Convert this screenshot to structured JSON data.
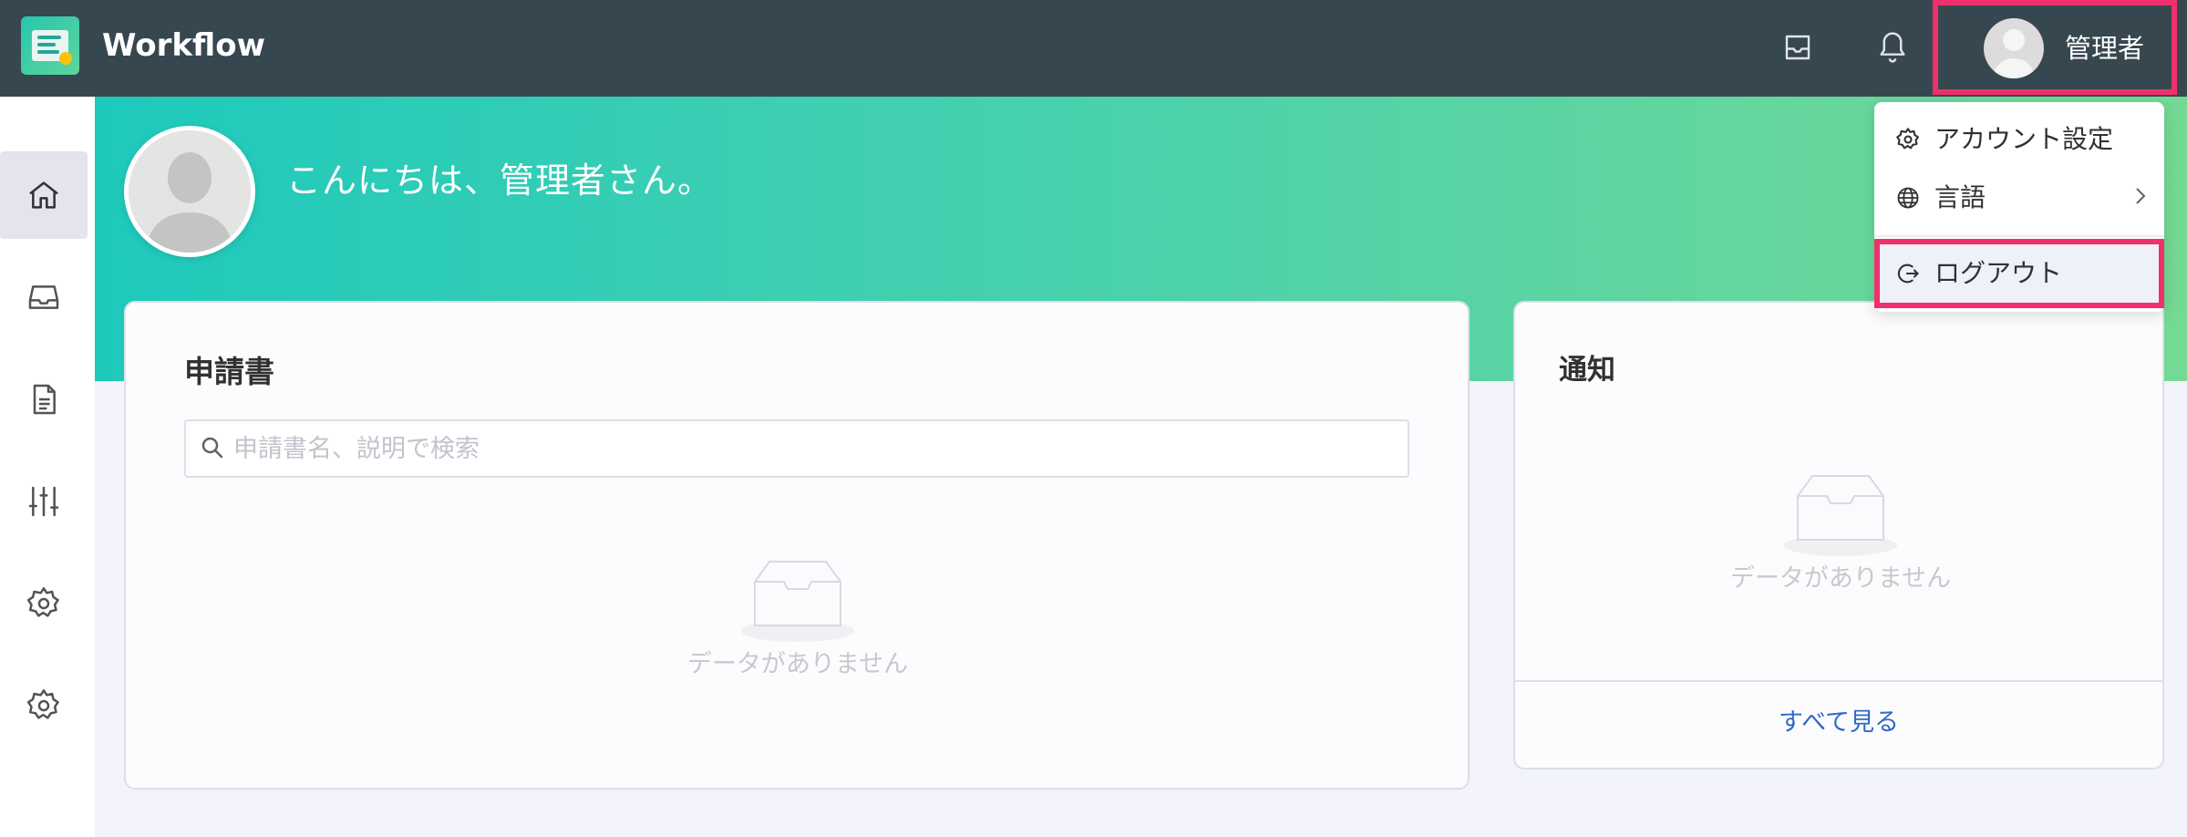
{
  "header": {
    "app_title": "Workflow",
    "user_name": "管理者",
    "icons": [
      "inbox-icon",
      "bell-icon"
    ]
  },
  "banner": {
    "greeting": "こんにちは、管理者さん。"
  },
  "sidebar": {
    "items": [
      {
        "icon": "home-icon",
        "active": true
      },
      {
        "icon": "inbox-icon",
        "active": false
      },
      {
        "icon": "document-icon",
        "active": false
      },
      {
        "icon": "sliders-icon",
        "active": false
      },
      {
        "icon": "gear-icon",
        "active": false
      },
      {
        "icon": "gear-icon",
        "active": false
      }
    ]
  },
  "applications_card": {
    "title": "申請書",
    "search_placeholder": "申請書名、説明で検索",
    "empty_text": "データがありません"
  },
  "notifications_card": {
    "title": "通知",
    "empty_text": "データがありません",
    "view_all": "すべて見る"
  },
  "user_menu": {
    "account_settings": "アカウント設定",
    "language": "言語",
    "logout": "ログアウト"
  },
  "colors": {
    "header_bg": "#37474f",
    "highlight": "#f0306c",
    "link": "#3069c5",
    "banner_start": "#1ec9bc",
    "banner_end": "#74d994"
  }
}
